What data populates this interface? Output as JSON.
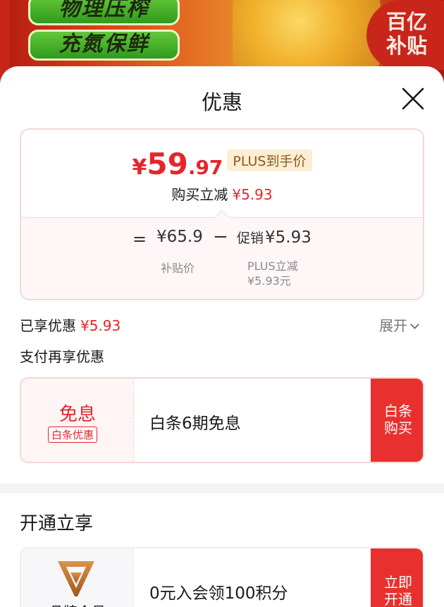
{
  "banner": {
    "pill_1": "物理压榨",
    "pill_2": "充氮保鲜",
    "badge_line_1": "百亿",
    "badge_line_2": "补贴"
  },
  "sheet": {
    "title": "优惠"
  },
  "price_card": {
    "currency": "¥",
    "price_int": "59",
    "price_dec": ".97",
    "plus_label": "PLUS到手价",
    "reduce_label": "购买立减",
    "reduce_amount": "¥5.93",
    "breakdown": {
      "equals": "=",
      "subsidy_price": "¥65.9",
      "minus": "−",
      "promo_label": "促销",
      "promo_amount": "¥5.93",
      "subsidy_label": "补贴价",
      "plus_reduce_label": "PLUS立减",
      "plus_reduce_amount": "¥5.93元"
    }
  },
  "enjoyed": {
    "label": "已享优惠",
    "amount": "¥5.93",
    "expand_label": "展开"
  },
  "pay_again_label": "支付再享优惠",
  "promo": {
    "headline": "免息",
    "tag": "白条优惠",
    "title": "白条6期免息",
    "button_line_1": "白条",
    "button_line_2": "购买"
  },
  "open_section": {
    "title": "开通立享",
    "member_name": "品牌会员",
    "member_title": "0元入会领100积分",
    "button_line_1": "立即",
    "button_line_2": "开通"
  },
  "colors": {
    "accent_red": "#e4262c",
    "button_red": "#e8312e",
    "plus_gold": "#8c5a1a"
  }
}
